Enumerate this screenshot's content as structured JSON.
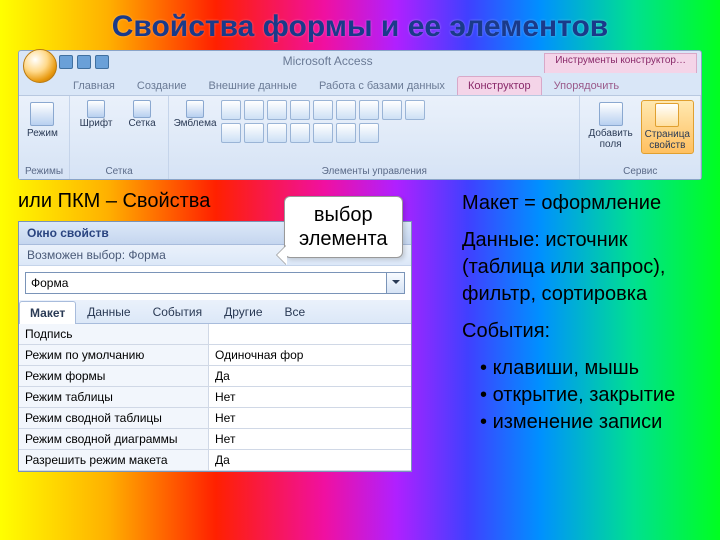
{
  "slide_title": "Свойства формы и ее элементов",
  "app_name": "Microsoft Access",
  "context_group": "Инструменты конструктор…",
  "tabs": {
    "home": "Главная",
    "create": "Создание",
    "external": "Внешние данные",
    "dbtools": "Работа с базами данных",
    "design": "Конструктор",
    "arrange": "Упорядочить"
  },
  "ribbon": {
    "group_modes": "Режимы",
    "group_grid": "Сетка",
    "group_controls": "Элементы управления",
    "group_service": "Сервис",
    "btn_mode": "Режим",
    "btn_font": "Шрифт",
    "btn_grid": "Сетка",
    "btn_logo": "Эмблема",
    "btn_addfields": "Добавить\nполя",
    "btn_propsheet": "Страница\nсвойств"
  },
  "pkm_text": "или ПКМ – Свойства",
  "callout": {
    "l1": "выбор",
    "l2": "элемента"
  },
  "propsheet": {
    "title": "Окно свойств",
    "subtitle": "Возможен выбор:  Форма",
    "combo_value": "Форма",
    "tabs": [
      "Макет",
      "Данные",
      "События",
      "Другие",
      "Все"
    ],
    "rows": [
      {
        "k": "Подпись",
        "v": ""
      },
      {
        "k": "Режим по умолчанию",
        "v": "Одиночная фор"
      },
      {
        "k": "Режим формы",
        "v": "Да"
      },
      {
        "k": "Режим таблицы",
        "v": "Нет"
      },
      {
        "k": "Режим сводной таблицы",
        "v": "Нет"
      },
      {
        "k": "Режим сводной диаграммы",
        "v": "Нет"
      },
      {
        "k": "Разрешить режим макета",
        "v": "Да"
      }
    ]
  },
  "notes": {
    "maket": "Макет = оформление",
    "data": "Данные: источник (таблица или запрос), фильтр, сортировка",
    "events_title": "События:",
    "events": [
      "клавиши, мышь",
      "открытие, закрытие",
      "изменение записи"
    ]
  }
}
